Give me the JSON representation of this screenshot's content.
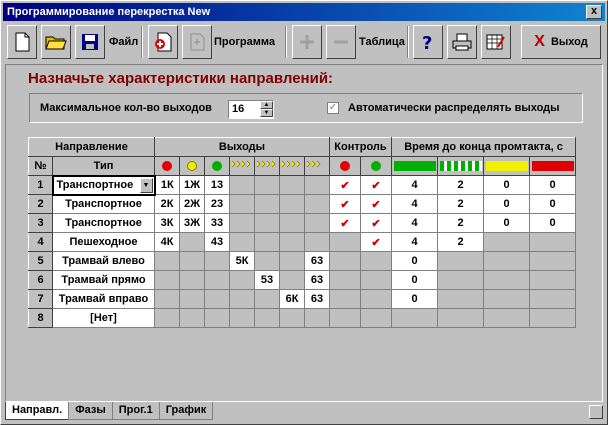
{
  "window": {
    "title": "Программирование перекрестка New",
    "close_label": "x"
  },
  "toolbar": {
    "file_label": "Файл",
    "program_label": "Программа",
    "table_label": "Таблица",
    "exit_label": "Выход",
    "exit_icon": "X"
  },
  "heading": "Назначьте характеристики направлений:",
  "options": {
    "max_outputs_label": "Максимальное кол-во выходов",
    "max_outputs_value": "16",
    "auto_label": "Автоматически распределять выходы",
    "auto_check": "✓"
  },
  "grid": {
    "h_direction": "Направление",
    "h_outputs": "Выходы",
    "h_control": "Контроль",
    "h_time": "Время до конца промтакта, с",
    "h_num": "№",
    "h_type": "Тип",
    "rows": [
      {
        "n": "1",
        "type": "Транспортное",
        "o1": "1К",
        "o2": "1Ж",
        "o3": "13",
        "o4": "",
        "o5": "",
        "o6": "",
        "o7": "",
        "c1": "✔",
        "c2": "✔",
        "t1": "4",
        "t2": "2",
        "t3": "0",
        "t4": "0"
      },
      {
        "n": "2",
        "type": "Транспортное",
        "o1": "2К",
        "o2": "2Ж",
        "o3": "23",
        "o4": "",
        "o5": "",
        "o6": "",
        "o7": "",
        "c1": "✔",
        "c2": "✔",
        "t1": "4",
        "t2": "2",
        "t3": "0",
        "t4": "0"
      },
      {
        "n": "3",
        "type": "Транспортное",
        "o1": "3К",
        "o2": "3Ж",
        "o3": "33",
        "o4": "",
        "o5": "",
        "o6": "",
        "o7": "",
        "c1": "✔",
        "c2": "✔",
        "t1": "4",
        "t2": "2",
        "t3": "0",
        "t4": "0"
      },
      {
        "n": "4",
        "type": "Пешеходное",
        "o1": "4К",
        "o2": "",
        "o3": "43",
        "o4": "",
        "o5": "",
        "o6": "",
        "o7": "",
        "c1": "",
        "c2": "✔",
        "t1": "4",
        "t2": "2",
        "t3": "",
        "t4": ""
      },
      {
        "n": "5",
        "type": "Трамвай влево",
        "o1": "",
        "o2": "",
        "o3": "",
        "o4": "5К",
        "o5": "",
        "o6": "",
        "o7": "63",
        "c1": "",
        "c2": "",
        "t1": "0",
        "t2": "",
        "t3": "",
        "t4": ""
      },
      {
        "n": "6",
        "type": "Трамвай прямо",
        "o1": "",
        "o2": "",
        "o3": "",
        "o4": "",
        "o5": "53",
        "o6": "",
        "o7": "63",
        "c1": "",
        "c2": "",
        "t1": "0",
        "t2": "",
        "t3": "",
        "t4": ""
      },
      {
        "n": "7",
        "type": "Трамвай вправо",
        "o1": "",
        "o2": "",
        "o3": "",
        "o4": "",
        "o5": "",
        "o6": "6К",
        "o7": "63",
        "c1": "",
        "c2": "",
        "t1": "0",
        "t2": "",
        "t3": "",
        "t4": ""
      },
      {
        "n": "8",
        "type": "[Нет]",
        "o1": "",
        "o2": "",
        "o3": "",
        "o4": "",
        "o5": "",
        "o6": "",
        "o7": "",
        "c1": "",
        "c2": "",
        "t1": "",
        "t2": "",
        "t3": "",
        "t4": ""
      }
    ]
  },
  "tabs": [
    "Направл.",
    "Фазы",
    "Прог.1",
    "График"
  ],
  "colors": {
    "red": "#e00000",
    "yellow": "#f0f000",
    "green": "#00b000",
    "title": "#000080",
    "heading": "#800000"
  }
}
